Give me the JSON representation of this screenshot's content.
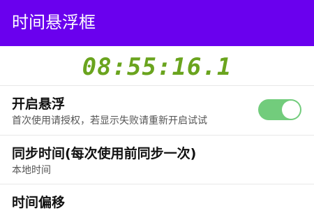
{
  "app_bar": {
    "title": "时间悬浮框",
    "color": "#6a00ee"
  },
  "clock": {
    "time": "08:55:16.1",
    "color": "#6aa41e"
  },
  "settings": {
    "float_toggle": {
      "title": "开启悬浮",
      "subtitle": "首次使用请授权，若显示失败请重新开启试试",
      "enabled": true,
      "track_color": "#72cc7c"
    },
    "sync_time": {
      "title": "同步时间(每次使用前同步一次)",
      "subtitle": "本地时间"
    },
    "time_offset": {
      "title": "时间偏移"
    }
  }
}
